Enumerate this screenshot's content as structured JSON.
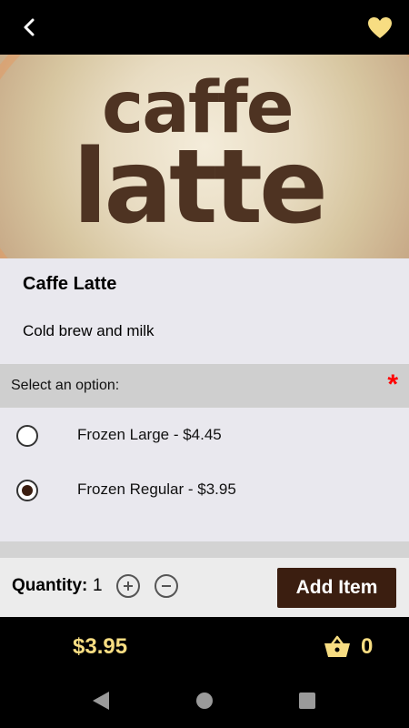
{
  "header": {
    "back_icon": "chevron-left-icon",
    "favorite_icon": "heart-icon"
  },
  "hero": {
    "line1": "caffe",
    "line2": "latte"
  },
  "product": {
    "title": "Caffe Latte",
    "description": "Cold brew and milk"
  },
  "options": {
    "header": "Select an option:",
    "required_marker": "*",
    "items": [
      {
        "label": "Frozen Large - $4.45",
        "selected": false
      },
      {
        "label": "Frozen Regular - $3.95",
        "selected": true
      }
    ]
  },
  "quantity": {
    "label": "Quantity:",
    "value": "1",
    "plus_icon": "plus-circle-icon",
    "minus_icon": "minus-circle-icon"
  },
  "add_button": {
    "label": "Add Item"
  },
  "footer": {
    "price": "$3.95",
    "cart_count": "0",
    "cart_icon": "basket-icon"
  },
  "colors": {
    "accent_brown": "#3b1e10",
    "price_gold": "#f7dd82",
    "required_red": "#ff0000"
  }
}
